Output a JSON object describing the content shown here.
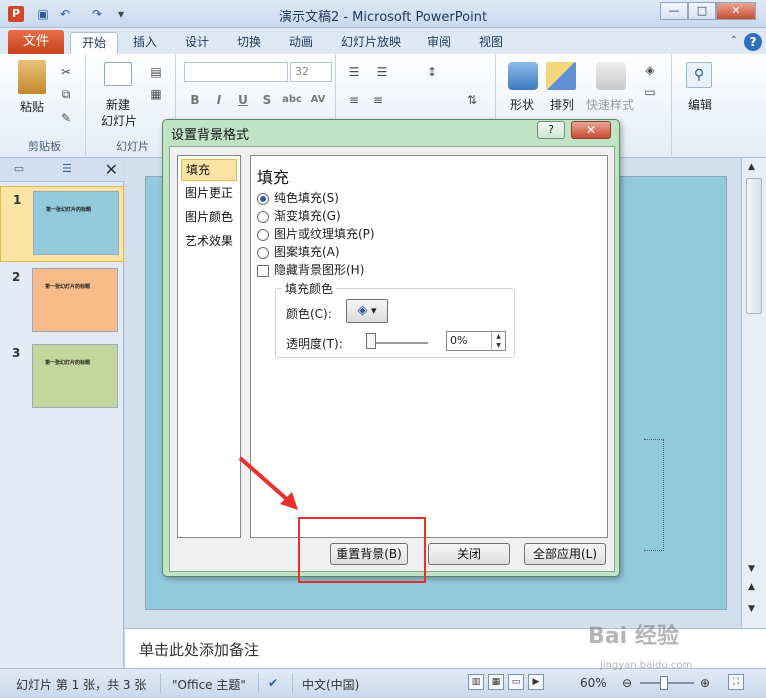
{
  "window": {
    "title": "演示文稿2 - Microsoft PowerPoint",
    "app_icon": "P",
    "controls": {
      "minimize": "—",
      "maximize": "□",
      "close": "✕"
    }
  },
  "qat": {
    "save_icon": "save-icon",
    "undo_icon": "undo-icon",
    "redo_icon": "redo-icon"
  },
  "ribbon_tabs": [
    "文件",
    "开始",
    "插入",
    "设计",
    "切换",
    "动画",
    "幻灯片放映",
    "审阅",
    "视图"
  ],
  "ribbon": {
    "clipboard": {
      "paste_label": "粘贴",
      "group_label": "剪贴板"
    },
    "slides": {
      "new_slide_line1": "新建",
      "new_slide_line2": "幻灯片",
      "group_label": "幻灯片"
    },
    "font": {
      "size": "32",
      "bold": "B",
      "italic": "I",
      "underline": "U",
      "strike": "S",
      "shadow": "abc",
      "spacing": "AV"
    },
    "drawing": {
      "shapes_label": "形状",
      "arrange_label": "排列",
      "quick_styles_label": "快速样式"
    },
    "editing": {
      "edit_label": "编辑"
    }
  },
  "slide_panel": {
    "thumb_caption": "第一张幻灯片的标题",
    "slides": [
      {
        "number": "1",
        "color": "#93c9dc"
      },
      {
        "number": "2",
        "color": "#f8bb8a"
      },
      {
        "number": "3",
        "color": "#c3d69b"
      }
    ]
  },
  "notes": {
    "placeholder": "单击此处添加备注"
  },
  "status": {
    "slide_info": "幻灯片 第 1 张，共 3 张",
    "theme": "\"Office 主题\"",
    "language": "中文(中国)",
    "zoom": "60%"
  },
  "dialog": {
    "title": "设置背景格式",
    "help_label": "?",
    "close_label": "✕",
    "categories": [
      "填充",
      "图片更正",
      "图片颜色",
      "艺术效果"
    ],
    "section_title": "填充",
    "options": [
      {
        "label": "纯色填充(S)",
        "checked": true
      },
      {
        "label": "渐变填充(G)",
        "checked": false
      },
      {
        "label": "图片或纹理填充(P)",
        "checked": false
      },
      {
        "label": "图案填充(A)",
        "checked": false
      }
    ],
    "hide_graphics_label": "隐藏背景图形(H)",
    "fill_color_group": "填充颜色",
    "color_label": "颜色(C):",
    "transparency_label": "透明度(T):",
    "transparency_value": "0%",
    "buttons": {
      "reset": "重置背景(B)",
      "close": "关闭",
      "apply_all": "全部应用(L)"
    }
  },
  "watermark": {
    "text": "Bai 经验",
    "sub": "jingyan.baidu.com"
  }
}
